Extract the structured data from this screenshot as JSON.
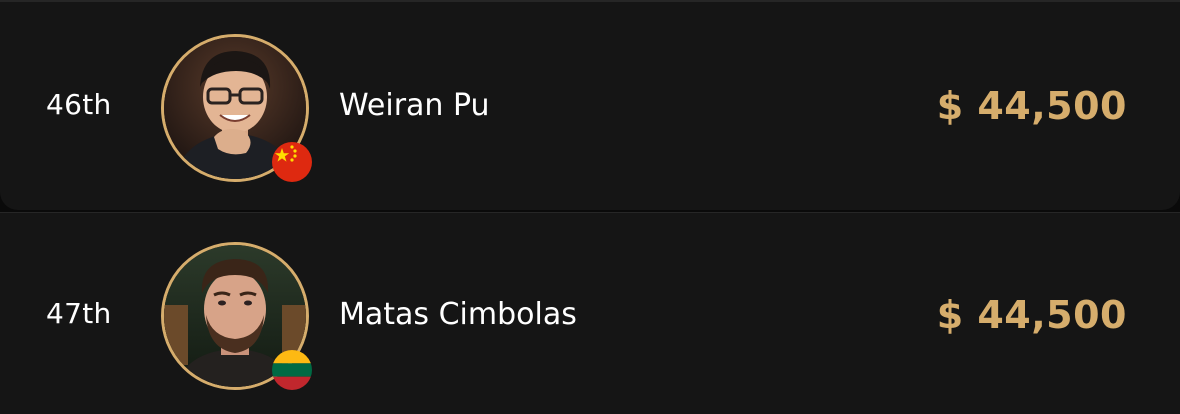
{
  "players": [
    {
      "rank": "46th",
      "name": "Weiran Pu",
      "prize": "$ 44,500",
      "country_flag": "china-flag-icon"
    },
    {
      "rank": "47th",
      "name": "Matas Cimbolas",
      "prize": "$ 44,500",
      "country_flag": "lithuania-flag-icon"
    }
  ],
  "colors": {
    "accent_gold": "#d6ad6c",
    "row_background": "#151515",
    "page_background": "#0a0a0a",
    "text_primary": "#ffffff"
  }
}
